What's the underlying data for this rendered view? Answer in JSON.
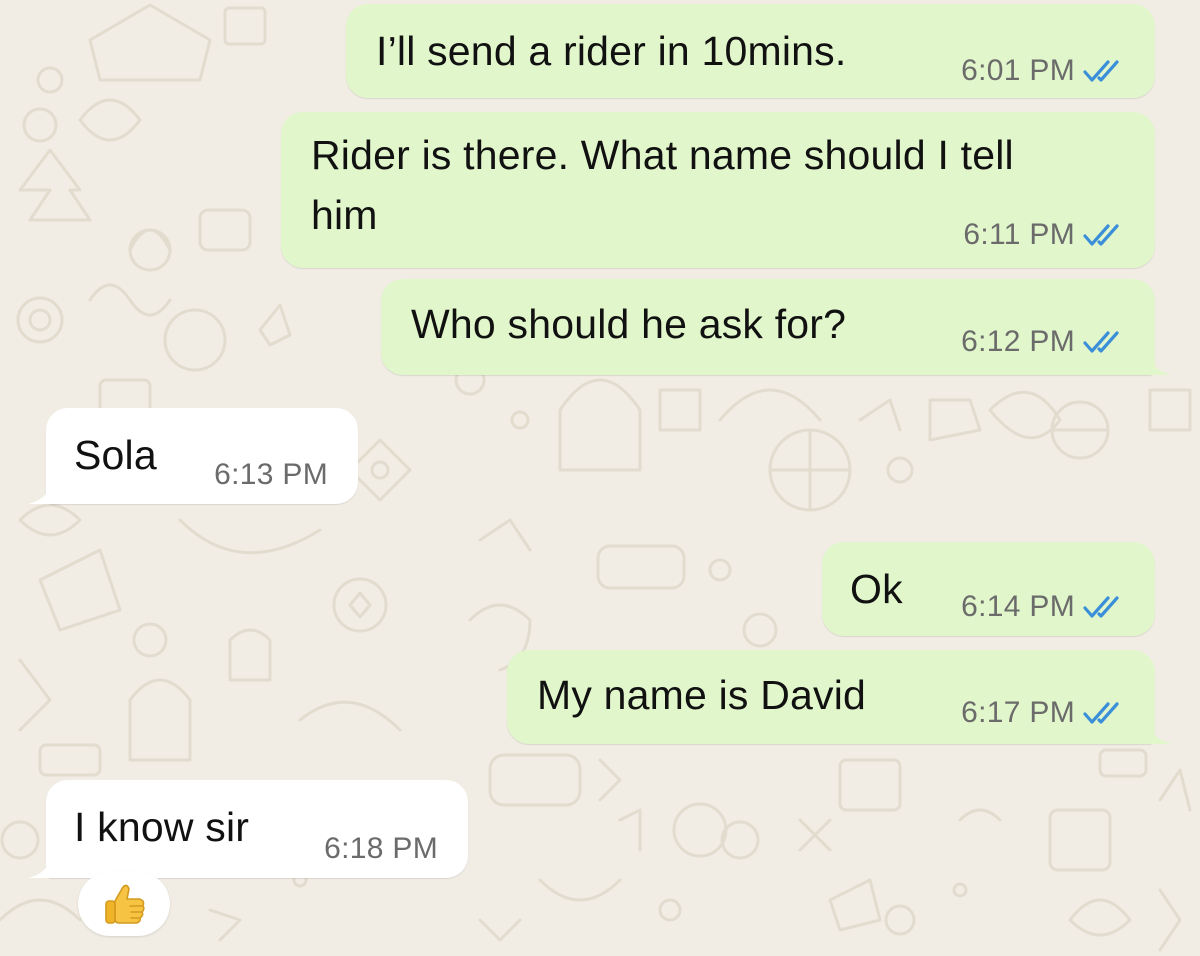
{
  "chat": {
    "messages": [
      {
        "id": "m1",
        "direction": "outgoing",
        "text": "I’ll send a rider in 10mins.",
        "time": "6:01 PM",
        "status": "read"
      },
      {
        "id": "m2",
        "direction": "outgoing",
        "text_line1": "Rider is there. What name should I tell",
        "text_line2": "him",
        "time": "6:11 PM",
        "status": "read"
      },
      {
        "id": "m3",
        "direction": "outgoing",
        "text": "Who should he ask for?",
        "time": "6:12 PM",
        "status": "read"
      },
      {
        "id": "m4",
        "direction": "incoming",
        "text": "Sola",
        "time": "6:13 PM"
      },
      {
        "id": "m5",
        "direction": "outgoing",
        "text": "Ok",
        "time": "6:14 PM",
        "status": "read"
      },
      {
        "id": "m6",
        "direction": "outgoing",
        "text": "My name is David",
        "time": "6:17 PM",
        "status": "read"
      },
      {
        "id": "m7",
        "direction": "incoming",
        "text": "I know sir",
        "time": "6:18 PM",
        "reaction": "👍"
      }
    ]
  },
  "colors": {
    "background": "#f1ede5",
    "outgoing_bubble": "#e1f7cb",
    "incoming_bubble": "#ffffff",
    "read_ticks": "#3b8fd9",
    "timestamp": "#6b6b6b"
  },
  "icons": {
    "read_receipt": "double-check-icon",
    "reaction": "thumbs-up-icon"
  }
}
